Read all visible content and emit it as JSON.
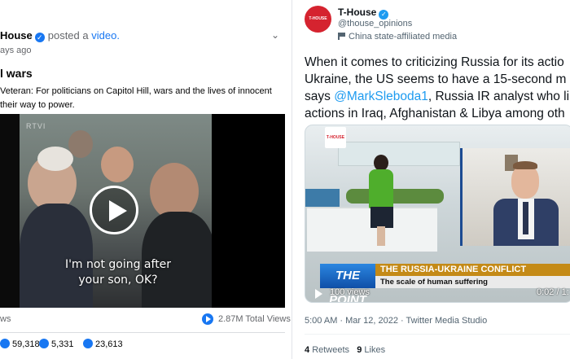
{
  "left_post": {
    "page_name": "House",
    "posted_text": "posted a",
    "video_link": "video.",
    "time": "ays ago",
    "title": "l wars",
    "description": "Veteran: For politicians on Capitol Hill, wars and the lives of innocent their way to power.",
    "video": {
      "caption": "I'm not going after your son, OK?",
      "watermark": "RTVI"
    },
    "stats": {
      "views_cut": "ws",
      "views_count": "2.87M Total Views"
    },
    "reactions": {
      "likes": "59,318",
      "comments": "5,331",
      "shares": "23,613"
    },
    "colors": {
      "accent": "#1877f2"
    }
  },
  "right_tweet": {
    "avatar_text": "T-HOUSE",
    "name": "T-House",
    "handle": "@thouse_opinions",
    "affiliation": "China state-affiliated media",
    "text_lines": [
      "When it comes to criticizing Russia for its actio",
      "Ukraine, the US seems to have a 15-second m",
      "says",
      "@MarkSleboda1",
      ", Russia IR analyst who li",
      "actions in Iraq, Afghanistan & Libya among oth"
    ],
    "media": {
      "logo_text": "T-HOUSE",
      "banner_left": "THE POINT",
      "banner_title": "THE RUSSIA-UKRAINE CONFLICT",
      "banner_sub": "The scale of human suffering",
      "views": "100 views",
      "time": "0:02 / 1:"
    },
    "meta": "5:00 AM · Mar 12, 2022 · Twitter Media Studio",
    "retweets_count": "4",
    "retweets_label": "Retweets",
    "likes_count": "9",
    "likes_label": "Likes",
    "colors": {
      "accent": "#1d9bf0",
      "brand": "#d5232f"
    }
  }
}
